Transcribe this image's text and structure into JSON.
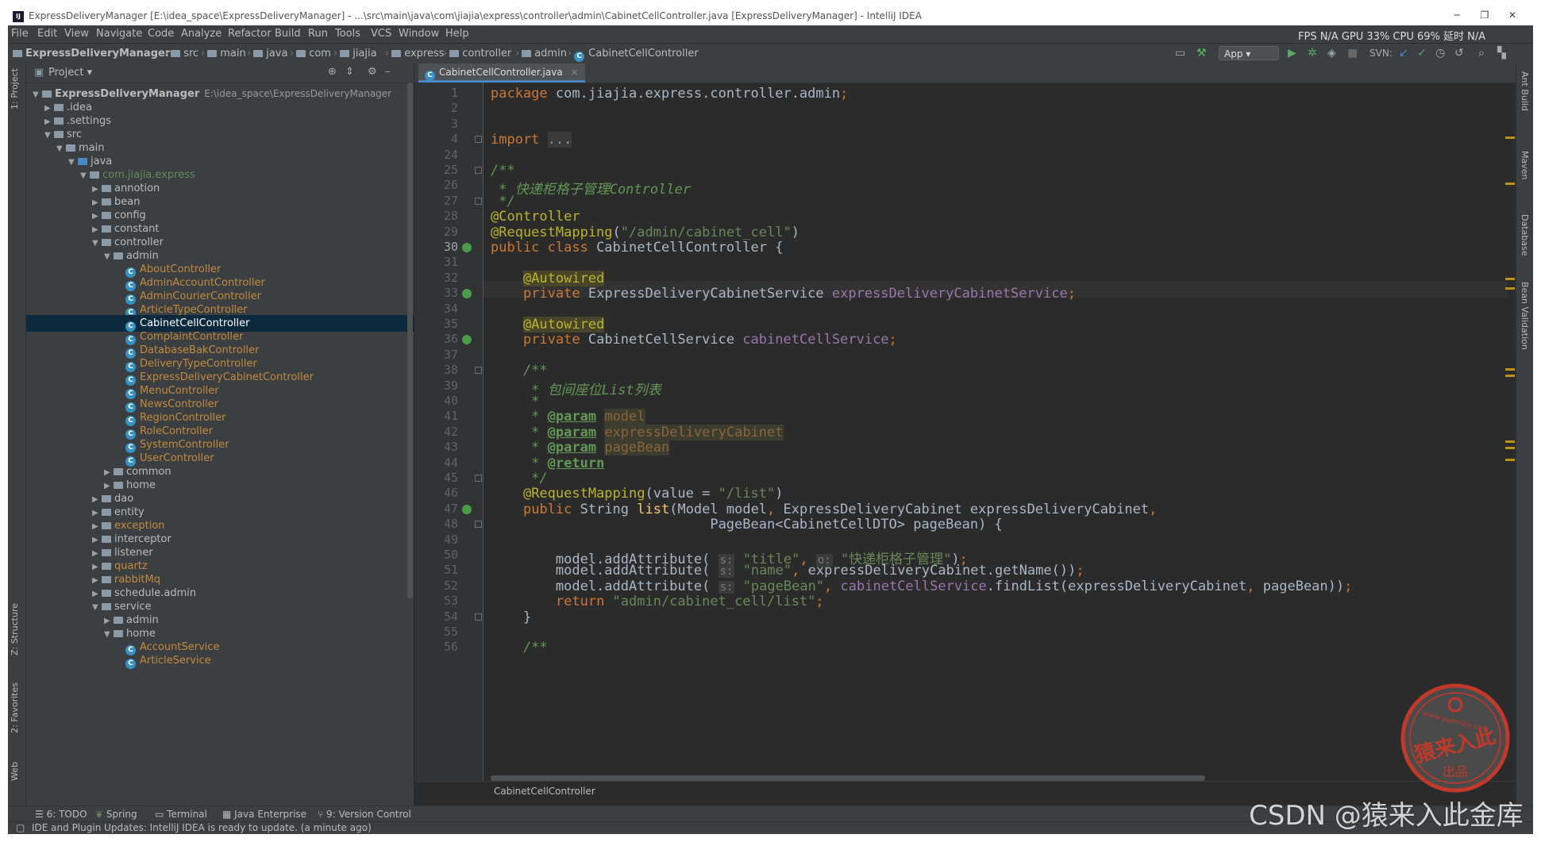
{
  "title_bar": {
    "text": "ExpressDeliveryManager [E:\\idea_space\\ExpressDeliveryManager] - ...\\src\\main\\java\\com\\jiajia\\express\\controller\\admin\\CabinetCellController.java [ExpressDeliveryManager] - IntelliJ IDEA",
    "minimize": "─",
    "restore": "❐",
    "close": "✕"
  },
  "menu": [
    "File",
    "Edit",
    "View",
    "Navigate",
    "Code",
    "Analyze",
    "Refactor",
    "Build",
    "Run",
    "Tools",
    "VCS",
    "Window",
    "Help"
  ],
  "stats": "FPS N/A GPU 33% CPU 69% 延时 N/A",
  "breadcrumbs": [
    "ExpressDeliveryManager",
    "src",
    "main",
    "java",
    "com",
    "jiajia",
    "express",
    "controller",
    "admin",
    "CabinetCellController"
  ],
  "run_config": "App",
  "svn_label": "SVN:",
  "project_panel": {
    "title": "Project",
    "rows": [
      {
        "label": "ExpressDeliveryManager",
        "extra": "E:\\idea_space\\ExpressDeliveryManager",
        "kind": "module",
        "expanded": true
      },
      {
        "label": ".idea",
        "kind": "folder",
        "expanded": false
      },
      {
        "label": ".settings",
        "kind": "folder",
        "expanded": false
      },
      {
        "label": "src",
        "kind": "folder",
        "expanded": true
      },
      {
        "label": "main",
        "kind": "folder",
        "expanded": true
      },
      {
        "label": "java",
        "kind": "source",
        "expanded": true
      },
      {
        "label": "com.jiajia.express",
        "kind": "package-green",
        "expanded": true
      },
      {
        "label": "annotion",
        "kind": "folder",
        "expanded": false
      },
      {
        "label": "bean",
        "kind": "folder",
        "expanded": false
      },
      {
        "label": "config",
        "kind": "folder",
        "expanded": false
      },
      {
        "label": "constant",
        "kind": "folder",
        "expanded": false
      },
      {
        "label": "controller",
        "kind": "folder",
        "expanded": true
      },
      {
        "label": "admin",
        "kind": "folder",
        "expanded": true
      },
      {
        "label": "AboutController",
        "kind": "class"
      },
      {
        "label": "AdminAccountController",
        "kind": "class"
      },
      {
        "label": "AdminCourierController",
        "kind": "class"
      },
      {
        "label": "ArticleTypeController",
        "kind": "class"
      },
      {
        "label": "CabinetCellController",
        "kind": "class",
        "selected": true
      },
      {
        "label": "ComplaintController",
        "kind": "class"
      },
      {
        "label": "DatabaseBakController",
        "kind": "class"
      },
      {
        "label": "DeliveryTypeController",
        "kind": "class"
      },
      {
        "label": "ExpressDeliveryCabinetController",
        "kind": "class"
      },
      {
        "label": "MenuController",
        "kind": "class"
      },
      {
        "label": "NewsController",
        "kind": "class"
      },
      {
        "label": "RegionController",
        "kind": "class"
      },
      {
        "label": "RoleController",
        "kind": "class"
      },
      {
        "label": "SystemController",
        "kind": "class"
      },
      {
        "label": "UserController",
        "kind": "class"
      },
      {
        "label": "common",
        "kind": "folder",
        "expanded": false
      },
      {
        "label": "home",
        "kind": "folder",
        "expanded": false
      },
      {
        "label": "dao",
        "kind": "folder",
        "expanded": false
      },
      {
        "label": "entity",
        "kind": "folder",
        "expanded": false
      },
      {
        "label": "exception",
        "kind": "package-orange",
        "expanded": false
      },
      {
        "label": "interceptor",
        "kind": "folder",
        "expanded": false
      },
      {
        "label": "listener",
        "kind": "folder",
        "expanded": false
      },
      {
        "label": "quartz",
        "kind": "package-orange",
        "expanded": false
      },
      {
        "label": "rabbitMq",
        "kind": "package-orange",
        "expanded": false
      },
      {
        "label": "schedule.admin",
        "kind": "folder",
        "expanded": false
      },
      {
        "label": "service",
        "kind": "folder",
        "expanded": true
      },
      {
        "label": "admin",
        "kind": "folder",
        "expanded": false
      },
      {
        "label": "home",
        "kind": "folder",
        "expanded": true
      },
      {
        "label": "AccountService",
        "kind": "class"
      },
      {
        "label": "ArticleService",
        "kind": "class"
      }
    ]
  },
  "editor": {
    "tab": "CabinetCellController.java",
    "breadcrumb": "CabinetCellController",
    "line_numbers": [
      "1",
      "2",
      "3",
      "4",
      "24",
      "25",
      "26",
      "27",
      "28",
      "29",
      "30",
      "31",
      "32",
      "33",
      "34",
      "35",
      "36",
      "37",
      "38",
      "39",
      "40",
      "41",
      "42",
      "43",
      "44",
      "45",
      "46",
      "47",
      "48",
      "49",
      "50",
      "51",
      "52",
      "53",
      "54",
      "55",
      "56"
    ],
    "lines": [
      [
        [
          "kw",
          "package "
        ],
        [
          "p",
          "com.jiajia.express.controller.admin"
        ],
        [
          "kw",
          ";"
        ]
      ],
      [],
      [],
      [
        [
          "kw",
          "import "
        ],
        [
          "folded",
          "..."
        ]
      ],
      [],
      [
        [
          "cmt",
          "/**"
        ]
      ],
      [
        [
          "cmt",
          " * 快递柜格子管理Controller"
        ]
      ],
      [
        [
          "cmt",
          " */"
        ]
      ],
      [
        [
          "ann",
          "@Controller"
        ]
      ],
      [
        [
          "ann",
          "@RequestMapping"
        ],
        [
          "p",
          "("
        ],
        [
          "str",
          "\"/admin/cabinet_cell\""
        ],
        [
          "p",
          ")"
        ]
      ],
      [
        [
          "kw",
          "public class "
        ],
        [
          "p",
          "CabinetCellController {"
        ]
      ],
      [],
      [
        [
          "p",
          "    "
        ],
        [
          "annbg",
          "@Autowired"
        ]
      ],
      [
        [
          "p",
          "    "
        ],
        [
          "kw",
          "private "
        ],
        [
          "p",
          "ExpressDeliveryCabinetService "
        ],
        [
          "fld",
          "expressDeliveryCabinetService"
        ],
        [
          "kw",
          ";"
        ]
      ],
      [],
      [
        [
          "p",
          "    "
        ],
        [
          "annbg",
          "@Autowired"
        ]
      ],
      [
        [
          "p",
          "    "
        ],
        [
          "kw",
          "private "
        ],
        [
          "p",
          "CabinetCellService "
        ],
        [
          "fld",
          "cabinetCellService"
        ],
        [
          "kw",
          ";"
        ]
      ],
      [],
      [
        [
          "cmt",
          "    /**"
        ]
      ],
      [
        [
          "cmt",
          "     * 包间座位List列表"
        ]
      ],
      [
        [
          "cmt",
          "     *"
        ]
      ],
      [
        [
          "cmt",
          "     * "
        ],
        [
          "doctag",
          "@param"
        ],
        [
          "cmt",
          " "
        ],
        [
          "parambg",
          "model"
        ]
      ],
      [
        [
          "cmt",
          "     * "
        ],
        [
          "doctag",
          "@param"
        ],
        [
          "cmt",
          " "
        ],
        [
          "parambg",
          "expressDeliveryCabinet"
        ]
      ],
      [
        [
          "cmt",
          "     * "
        ],
        [
          "doctag",
          "@param"
        ],
        [
          "cmt",
          " "
        ],
        [
          "parambg",
          "pageBean"
        ]
      ],
      [
        [
          "cmt",
          "     * "
        ],
        [
          "doctag",
          "@return"
        ]
      ],
      [
        [
          "cmt",
          "     */"
        ]
      ],
      [
        [
          "p",
          "    "
        ],
        [
          "ann",
          "@RequestMapping"
        ],
        [
          "p",
          "(value = "
        ],
        [
          "str",
          "\"/list\""
        ],
        [
          "p",
          ")"
        ]
      ],
      [
        [
          "p",
          "    "
        ],
        [
          "kw",
          "public "
        ],
        [
          "p",
          "String "
        ],
        [
          "fn",
          "list"
        ],
        [
          "p",
          "(Model model"
        ],
        [
          "kw",
          ", "
        ],
        [
          "p",
          "ExpressDeliveryCabinet expressDeliveryCabinet"
        ],
        [
          "kw",
          ","
        ]
      ],
      [
        [
          "p",
          "                           PageBean<CabinetCellDTO> pageBean) {"
        ]
      ],
      [],
      [
        [
          "p",
          "        model.addAttribute( "
        ],
        [
          "hint",
          "s:"
        ],
        [
          "p",
          " "
        ],
        [
          "str",
          "\"title\""
        ],
        [
          "kw",
          ", "
        ],
        [
          "hint",
          "o:"
        ],
        [
          "p",
          " "
        ],
        [
          "str",
          "\"快递柜格子管理\""
        ],
        [
          "p",
          ")"
        ],
        [
          "kw",
          ";"
        ]
      ],
      [
        [
          "p",
          "        model.addAttribute( "
        ],
        [
          "hint",
          "s:"
        ],
        [
          "p",
          " "
        ],
        [
          "str",
          "\"name\""
        ],
        [
          "kw",
          ", "
        ],
        [
          "p",
          "expressDeliveryCabinet.getName())"
        ],
        [
          "kw",
          ";"
        ]
      ],
      [
        [
          "p",
          "        model.addAttribute( "
        ],
        [
          "hint",
          "s:"
        ],
        [
          "p",
          " "
        ],
        [
          "str",
          "\"pageBean\""
        ],
        [
          "kw",
          ", "
        ],
        [
          "fld",
          "cabinetCellService"
        ],
        [
          "p",
          ".findList(expressDeliveryCabinet"
        ],
        [
          "kw",
          ", "
        ],
        [
          "p",
          "pageBean))"
        ],
        [
          "kw",
          ";"
        ]
      ],
      [
        [
          "p",
          "        "
        ],
        [
          "kw",
          "return "
        ],
        [
          "str",
          "\"admin/cabinet_cell/list\""
        ],
        [
          "kw",
          ";"
        ]
      ],
      [
        [
          "p",
          "    }"
        ]
      ],
      [],
      [
        [
          "cmt",
          "    /**"
        ]
      ]
    ]
  },
  "left_tabs": [
    "1: Project",
    "Z: Structure",
    "2: Favorites",
    "Web"
  ],
  "right_tabs": [
    "Ant Build",
    "Maven",
    "Database",
    "Bean Validation"
  ],
  "bottom_tools": [
    "6: TODO",
    "Spring",
    "Terminal",
    "Java Enterprise",
    "9: Version Control"
  ],
  "status_text": "IDE and Plugin Updates: IntelliJ IDEA is ready to update. (a minute ago)",
  "watermark": "CSDN @猿来入此金库",
  "seal_text": {
    "top": "www.yuanrice.com",
    "middle": "猿来入此",
    "bottom": "出品"
  },
  "colors": {
    "accent": "#4a88c7",
    "selection": "#0d293e",
    "keyword": "#cc7832",
    "string": "#6a8759",
    "annotation": "#bbb529",
    "field": "#9876aa",
    "seal": "#c0392b"
  }
}
